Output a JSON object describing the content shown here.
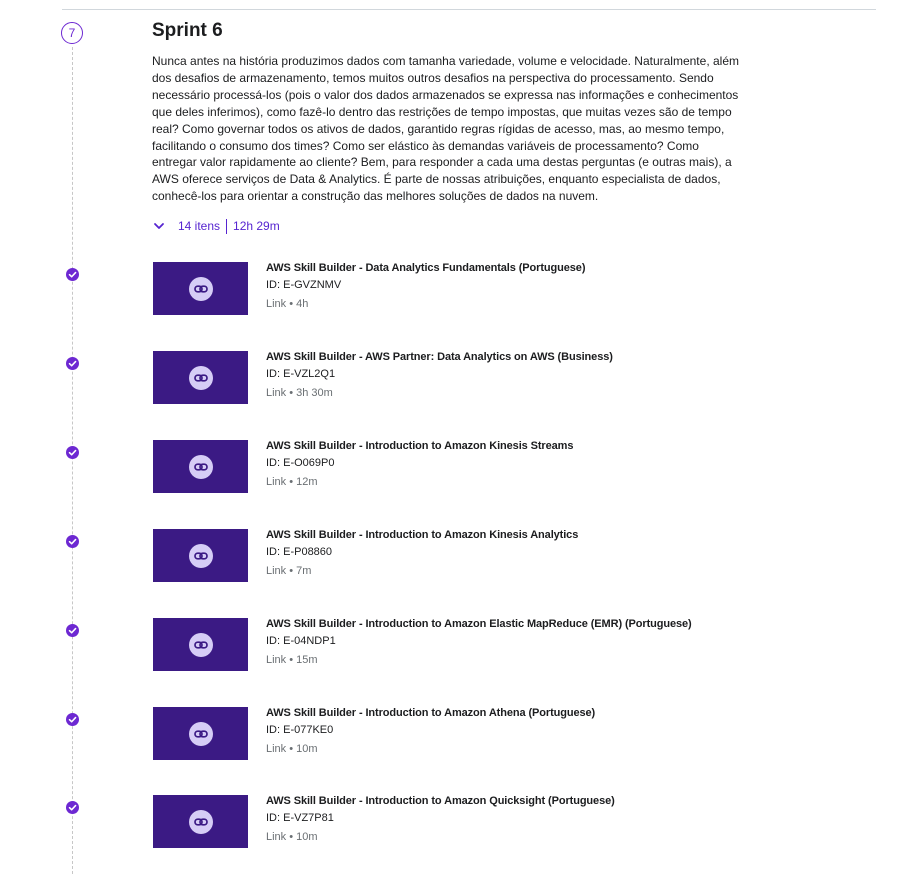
{
  "section": {
    "step_number": "7",
    "title": "Sprint 6",
    "description": "Nunca antes na história produzimos dados com tamanha variedade, volume e velocidade. Naturalmente, além dos desafios de armazenamento, temos muitos outros desafios na perspectiva do processamento. Sendo necessário processá-los (pois o valor dos dados armazenados se expressa nas informações e conhecimentos que deles inferimos), como fazê-lo dentro das restrições de tempo impostas, que muitas vezes são de tempo real? Como governar todos os ativos de dados, garantido regras rígidas de acesso, mas, ao mesmo tempo, facilitando o consumo dos times? Como ser elástico às demandas variáveis de processamento? Como entregar valor rapidamente ao cliente? Bem, para responder a cada uma destas perguntas (e outras mais), a AWS oferece serviços de Data & Analytics. É parte de nossas atribuições, enquanto especialista de dados, conhecê-los para orientar a construção das melhores soluções de dados na nuvem.",
    "items_count": "14 itens",
    "duration": "12h 29m"
  },
  "colors": {
    "accent": "#5624d0",
    "thumbnail": "#3b1a84",
    "check": "#6d28d2"
  },
  "icons": {
    "expand": "chevron-down-icon",
    "complete": "check-circle-icon",
    "link": "link-icon"
  },
  "items": [
    {
      "title": "AWS Skill Builder - Data Analytics Fundamentals (Portuguese)",
      "id": "ID: E-GVZNMV",
      "meta": "Link • 4h"
    },
    {
      "title": "AWS Skill Builder - AWS Partner: Data Analytics on AWS (Business)",
      "id": "ID: E-VZL2Q1",
      "meta": "Link • 3h 30m"
    },
    {
      "title": "AWS Skill Builder - Introduction to Amazon Kinesis Streams",
      "id": "ID: E-O069P0",
      "meta": "Link • 12m"
    },
    {
      "title": "AWS Skill Builder - Introduction to Amazon Kinesis Analytics",
      "id": "ID: E-P08860",
      "meta": "Link • 7m"
    },
    {
      "title": "AWS Skill Builder - Introduction to Amazon Elastic MapReduce (EMR) (Portuguese)",
      "id": "ID: E-04NDP1",
      "meta": "Link • 15m"
    },
    {
      "title": "AWS Skill Builder - Introduction to Amazon Athena (Portuguese)",
      "id": "ID: E-077KE0",
      "meta": "Link • 10m"
    },
    {
      "title": "AWS Skill Builder - Introduction to Amazon Quicksight (Portuguese)",
      "id": "ID: E-VZ7P81",
      "meta": "Link • 10m"
    }
  ]
}
